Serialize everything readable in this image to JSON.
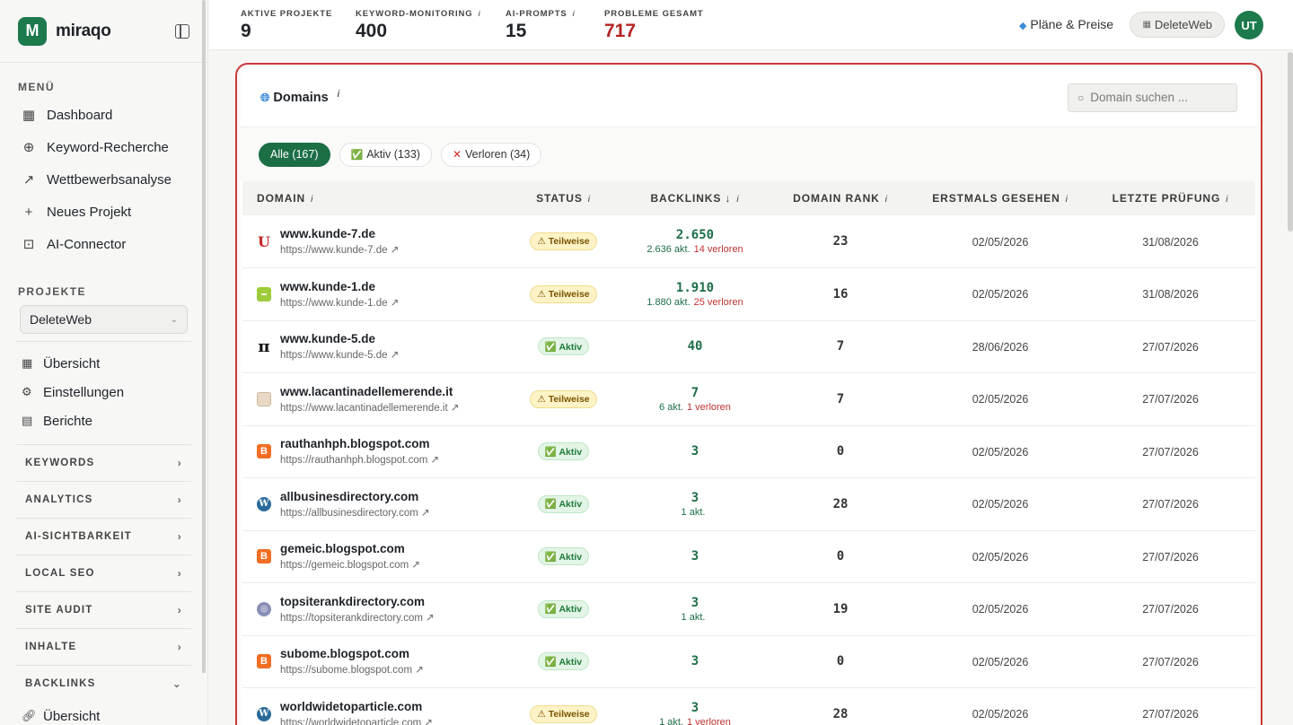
{
  "brand": {
    "name": "miraqo",
    "logo_letter": "M"
  },
  "sidebar": {
    "menu_title": "MENÜ",
    "menu": [
      {
        "label": "Dashboard",
        "icon": "grid-icon"
      },
      {
        "label": "Keyword-Recherche",
        "icon": "search-plus-icon"
      },
      {
        "label": "Wettbewerbsanalyse",
        "icon": "line-chart-icon"
      },
      {
        "label": "Neues Projekt",
        "icon": "plus-icon"
      },
      {
        "label": "AI-Connector",
        "icon": "robot-icon"
      }
    ],
    "projects_title": "PROJEKTE",
    "project_select": "DeleteWeb",
    "project_menu": [
      {
        "label": "Übersicht",
        "icon": "grid-small-icon"
      },
      {
        "label": "Einstellungen",
        "icon": "gear-icon"
      },
      {
        "label": "Berichte",
        "icon": "document-icon"
      }
    ],
    "groups": [
      "KEYWORDS",
      "ANALYTICS",
      "AI-SICHTBARKEIT",
      "LOCAL SEO",
      "SITE AUDIT",
      "INHALTE"
    ],
    "backlinks_group": "BACKLINKS",
    "backlinks_item": "Übersicht"
  },
  "header": {
    "stats": [
      {
        "label": "AKTIVE PROJEKTE",
        "value": "9",
        "info": false
      },
      {
        "label": "KEYWORD-MONITORING",
        "value": "400",
        "info": true
      },
      {
        "label": "AI-PROMPTS",
        "value": "15",
        "info": true
      },
      {
        "label": "PROBLEME GESAMT",
        "value": "717",
        "info": false
      }
    ],
    "plans_label": "Pläne & Preise",
    "project_button": "DeleteWeb",
    "avatar_initials": "UT"
  },
  "domains": {
    "title": "Domains",
    "search_placeholder": "Domain suchen ...",
    "filters": [
      "Alle (167)",
      "Aktiv (133)",
      "Verloren (34)"
    ],
    "columns": [
      "DOMAIN",
      "STATUS",
      "BACKLINKS ↓",
      "DOMAIN RANK",
      "ERSTMALS GESEHEN",
      "LETZTE PRÜFUNG"
    ],
    "rows": [
      {
        "name": "www.kunde-7.de",
        "url": "https://www.kunde-7.de ↗",
        "favicon": "u",
        "fav_text": "U",
        "status": "⚠ Teilweise",
        "status_type": "part",
        "backlinks": "2.650",
        "active": "2.636 akt.",
        "lost": "14 verloren",
        "rank": "23",
        "first_seen": "02/05/2026",
        "last_check": "31/08/2026"
      },
      {
        "name": "www.kunde-1.de",
        "url": "https://www.kunde-1.de ↗",
        "favicon": "lime",
        "fav_text": "▬",
        "status": "⚠ Teilweise",
        "status_type": "part",
        "backlinks": "1.910",
        "active": "1.880 akt.",
        "lost": "25 verloren",
        "rank": "16",
        "first_seen": "02/05/2026",
        "last_check": "31/08/2026"
      },
      {
        "name": "www.kunde-5.de",
        "url": "https://www.kunde-5.de ↗",
        "favicon": "pi",
        "fav_text": "π",
        "status": "✅ Aktiv",
        "status_type": "act",
        "backlinks": "40",
        "active": "",
        "lost": "",
        "rank": "7",
        "first_seen": "28/06/2026",
        "last_check": "27/07/2026"
      },
      {
        "name": "www.lacantinadellemerende.it",
        "url": "https://www.lacantinadellemerende.it ↗",
        "favicon": "cantina",
        "fav_text": "",
        "status": "⚠ Teilweise",
        "status_type": "part",
        "backlinks": "7",
        "active": "6 akt.",
        "lost": "1 verloren",
        "rank": "7",
        "first_seen": "02/05/2026",
        "last_check": "27/07/2026"
      },
      {
        "name": "rauthanhph.blogspot.com",
        "url": "https://rauthanhph.blogspot.com ↗",
        "favicon": "blogger",
        "fav_text": "B",
        "status": "✅ Aktiv",
        "status_type": "act",
        "backlinks": "3",
        "active": "",
        "lost": "",
        "rank": "0",
        "first_seen": "02/05/2026",
        "last_check": "27/07/2026"
      },
      {
        "name": "allbusinesdirectory.com",
        "url": "https://allbusinesdirectory.com ↗",
        "favicon": "wp",
        "fav_text": "W",
        "status": "✅ Aktiv",
        "status_type": "act",
        "backlinks": "3",
        "active": "1 akt.",
        "lost": "",
        "rank": "28",
        "first_seen": "02/05/2026",
        "last_check": "27/07/2026"
      },
      {
        "name": "gemeic.blogspot.com",
        "url": "https://gemeic.blogspot.com ↗",
        "favicon": "blogger",
        "fav_text": "B",
        "status": "✅ Aktiv",
        "status_type": "act",
        "backlinks": "3",
        "active": "",
        "lost": "",
        "rank": "0",
        "first_seen": "02/05/2026",
        "last_check": "27/07/2026"
      },
      {
        "name": "topsiterankdirectory.com",
        "url": "https://topsiterankdirectory.com ↗",
        "favicon": "globe",
        "fav_text": "◎",
        "status": "✅ Aktiv",
        "status_type": "act",
        "backlinks": "3",
        "active": "1 akt.",
        "lost": "",
        "rank": "19",
        "first_seen": "02/05/2026",
        "last_check": "27/07/2026"
      },
      {
        "name": "subome.blogspot.com",
        "url": "https://subome.blogspot.com ↗",
        "favicon": "blogger",
        "fav_text": "B",
        "status": "✅ Aktiv",
        "status_type": "act",
        "backlinks": "3",
        "active": "",
        "lost": "",
        "rank": "0",
        "first_seen": "02/05/2026",
        "last_check": "27/07/2026"
      },
      {
        "name": "worldwidetoparticle.com",
        "url": "https://worldwidetoparticle.com ↗",
        "favicon": "wp",
        "fav_text": "W",
        "status": "⚠ Teilweise",
        "status_type": "part",
        "backlinks": "3",
        "active": "1 akt.",
        "lost": "1 verloren",
        "rank": "28",
        "first_seen": "02/05/2026",
        "last_check": "27/07/2026"
      }
    ]
  }
}
